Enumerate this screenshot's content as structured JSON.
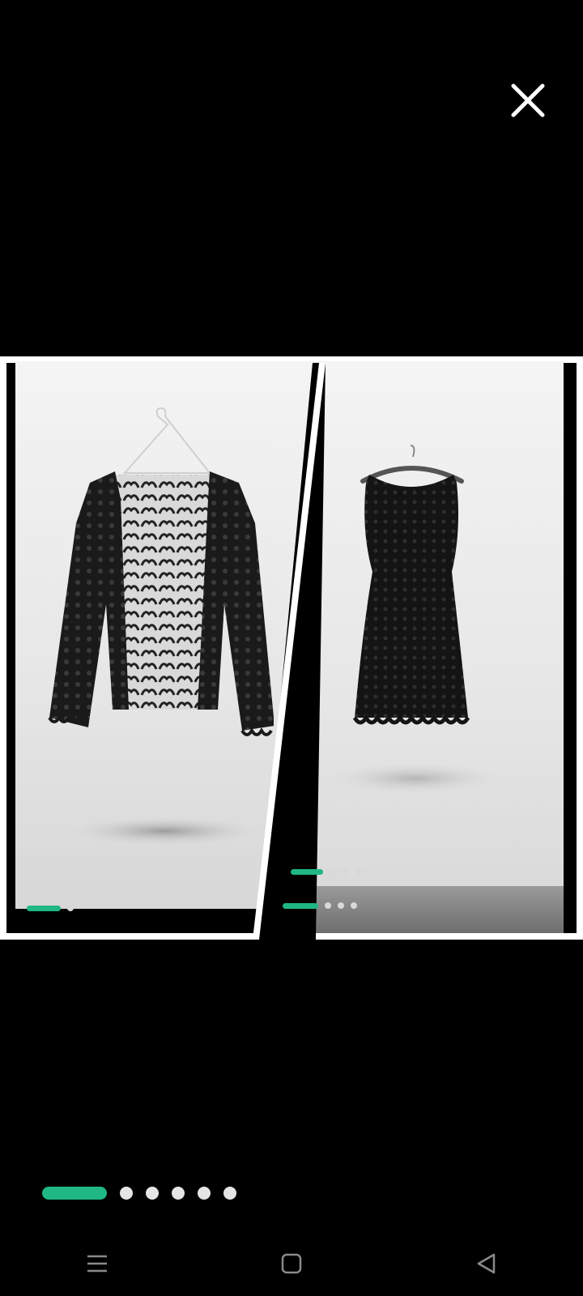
{
  "viewer": {
    "close_icon": "close-icon",
    "collage": [
      {
        "item": "lace-cardigan",
        "mini_pager": {
          "active_index": 0,
          "total": 2
        }
      },
      {
        "item": "lace-dress",
        "mini_pager_upper": {
          "active_index": 0,
          "total": 4
        },
        "mini_pager_lower": {
          "active_index": 0,
          "total": 4
        }
      }
    ],
    "pager": {
      "active_index": 0,
      "total": 6
    }
  },
  "system_nav": {
    "buttons": [
      "menu-icon",
      "home-icon",
      "back-icon"
    ]
  },
  "colors": {
    "background": "#000000",
    "accent": "#1fb784",
    "dot_inactive": "#e5e5e5"
  }
}
